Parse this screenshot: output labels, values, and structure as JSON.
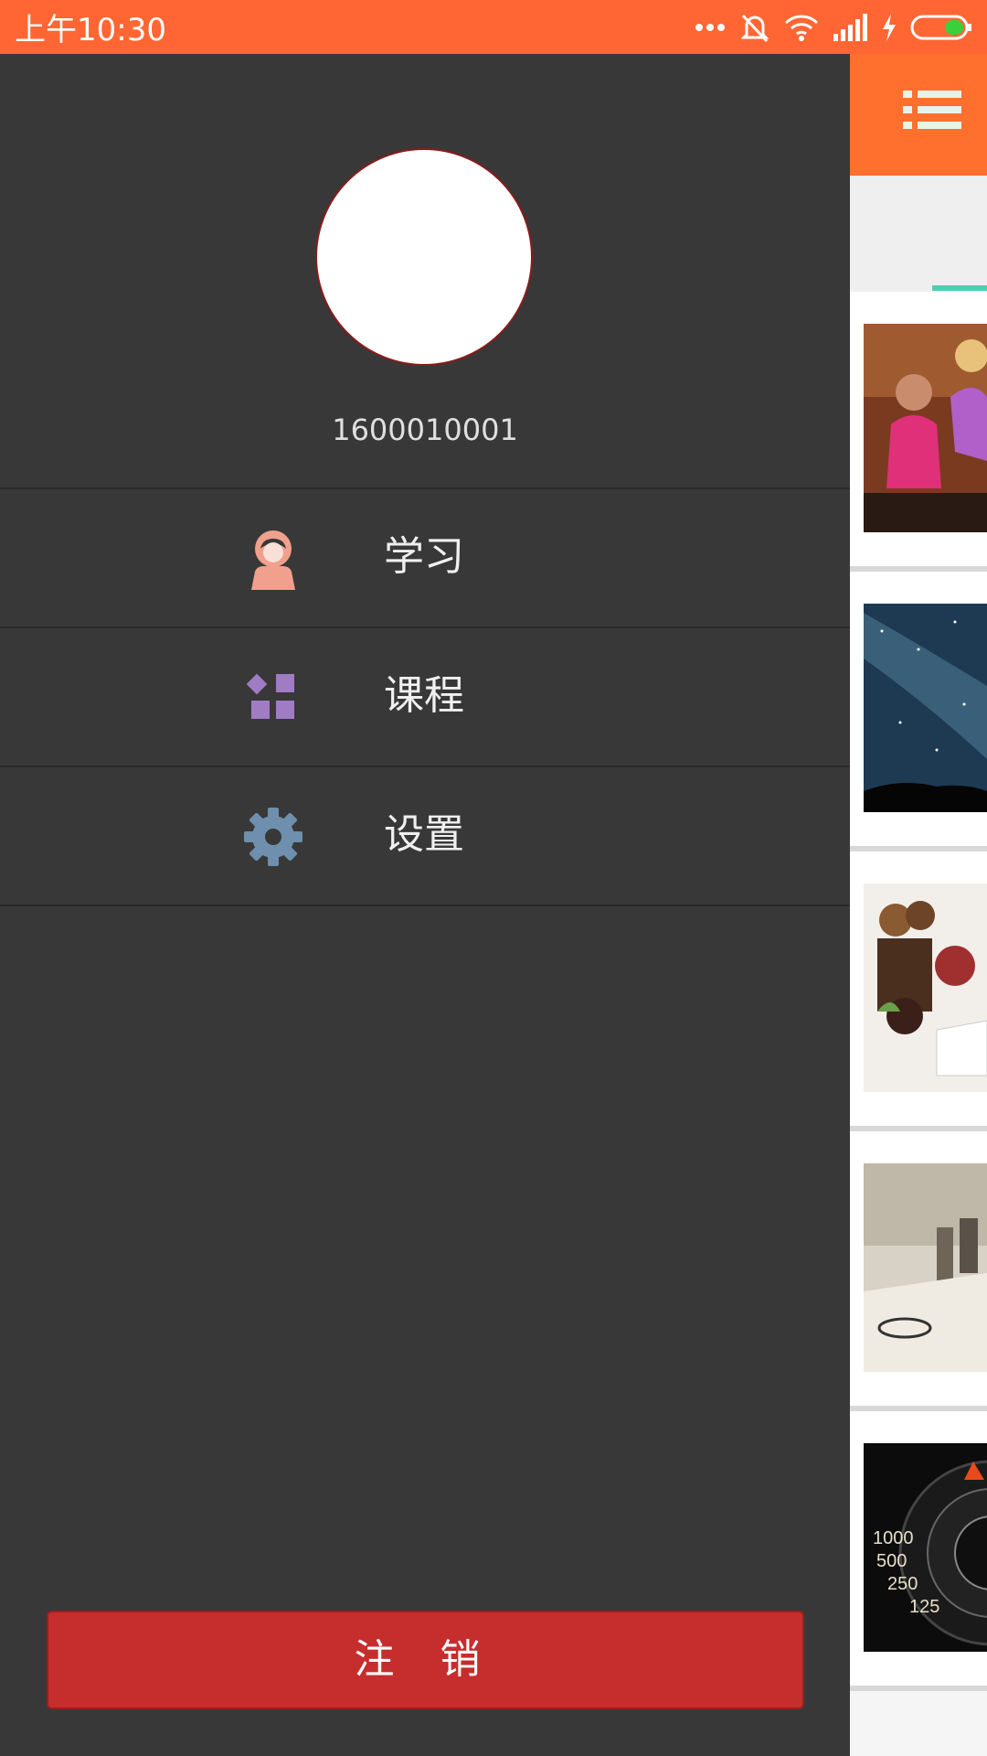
{
  "status_bar": {
    "time": "上午10:30",
    "icons": [
      "more-dots-icon",
      "mute-icon",
      "wifi-icon",
      "signal-icon",
      "charging-icon",
      "battery-icon"
    ],
    "background": "#ff6633"
  },
  "drawer": {
    "user_id": "1600010001",
    "menu": [
      {
        "label": "学习",
        "icon": "learner-avatar-icon",
        "icon_color": "#f0a08c"
      },
      {
        "label": "课程",
        "icon": "course-grid-icon",
        "icon_color": "#a07cc5"
      },
      {
        "label": "设置",
        "icon": "gear-icon",
        "icon_color": "#6e8fad"
      }
    ],
    "logout_label": "注 销",
    "logout_color": "#c62d2d",
    "background": "#383838"
  },
  "content": {
    "toolbar_color": "#ff6f2e",
    "toolbar_icon": "list-menu-icon",
    "tab_indicator_color": "#4dd0b1",
    "items": [
      {
        "thumbnail": "students-photo"
      },
      {
        "thumbnail": "night-sky-photo"
      },
      {
        "thumbnail": "mushrooms-photo"
      },
      {
        "thumbnail": "classroom-photo"
      },
      {
        "thumbnail": "camera-dial-photo"
      }
    ]
  }
}
